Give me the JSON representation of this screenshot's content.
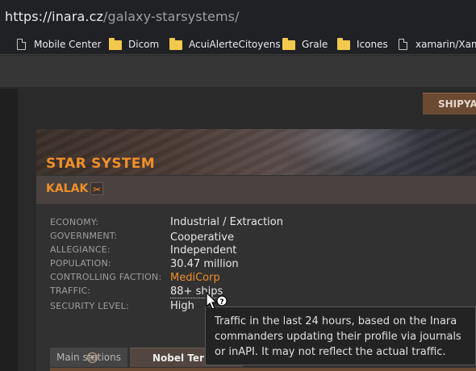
{
  "browser": {
    "url_host": "https://inara.cz",
    "url_path": "/galaxy-starsystems/"
  },
  "bookmarks": [
    {
      "label": "Mobile Center",
      "icon": "page-icon"
    },
    {
      "label": "Dicom",
      "icon": "folder-icon"
    },
    {
      "label": "AcuiAlerteCitoyens",
      "icon": "folder-icon"
    },
    {
      "label": "Grale",
      "icon": "folder-icon"
    },
    {
      "label": "Icones",
      "icon": "folder-icon"
    },
    {
      "label": "xamarin/Xama",
      "icon": "page-icon"
    }
  ],
  "nav": {
    "shipyard_label": "SHIPYAR"
  },
  "system": {
    "section_title": "STAR SYSTEM",
    "name": "KALAK",
    "copy_icon": "scissors-icon"
  },
  "details": [
    {
      "label": "ECONOMY:",
      "value": "Industrial / Extraction"
    },
    {
      "label": "GOVERNMENT:",
      "value": "Cooperative"
    },
    {
      "label": "ALLEGIANCE:",
      "value": "Independent"
    },
    {
      "label": "POPULATION:",
      "value": "30.47 million"
    },
    {
      "label": "CONTROLLING FACTION:",
      "value": "MediCorp"
    },
    {
      "label": "TRAFFIC:",
      "value": "88+ ships"
    },
    {
      "label": "SECURITY LEVEL:",
      "value": "High"
    }
  ],
  "tabs": [
    {
      "label": "Main stations"
    },
    {
      "label": "Nobel Tern"
    }
  ],
  "tooltip": {
    "text": "Traffic in the last 24 hours, based on the Inara commanders updating their profile via journals or inAPI. It may not reflect the actual traffic."
  },
  "colors": {
    "accent": "#f0902a",
    "background": "#2a2a2a"
  }
}
